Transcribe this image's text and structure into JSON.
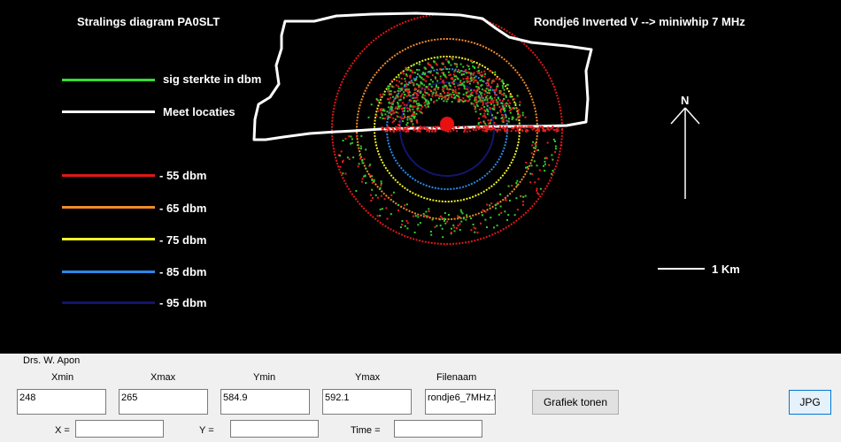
{
  "plot": {
    "title": "Stralings diagram PA0SLT",
    "subtitle": "Rondje6  Inverted V  --> miniwhip 7 MHz",
    "north_label": "N",
    "scale_label": "1 Km",
    "legend": [
      {
        "label": "sig sterkte in dbm",
        "color": "#33dd33"
      },
      {
        "label": "Meet locaties",
        "color": "#ffffff"
      },
      {
        "label": "- 55 dbm",
        "color": "#e01818"
      },
      {
        "label": "- 65 dbm",
        "color": "#f08a2a"
      },
      {
        "label": "- 75 dbm",
        "color": "#f2f226"
      },
      {
        "label": "- 85 dbm",
        "color": "#2a8ae8"
      },
      {
        "label": "- 95 dbm",
        "color": "#14146e"
      }
    ]
  },
  "controls": {
    "author": "Drs. W. Apon",
    "xmin": {
      "label": "Xmin",
      "value": "248"
    },
    "xmax": {
      "label": "Xmax",
      "value": "265"
    },
    "ymin": {
      "label": "Ymin",
      "value": "584.9"
    },
    "ymax": {
      "label": "Ymax",
      "value": "592.1"
    },
    "filename": {
      "label": "Filenaam",
      "value": "rondje6_7MHz.t"
    },
    "show_button": "Grafiek tonen",
    "jpg_button": "JPG",
    "x_label": "X =",
    "y_label": "Y =",
    "time_label": "Time  =",
    "x_value": "",
    "y_value": "",
    "time_value": ""
  }
}
